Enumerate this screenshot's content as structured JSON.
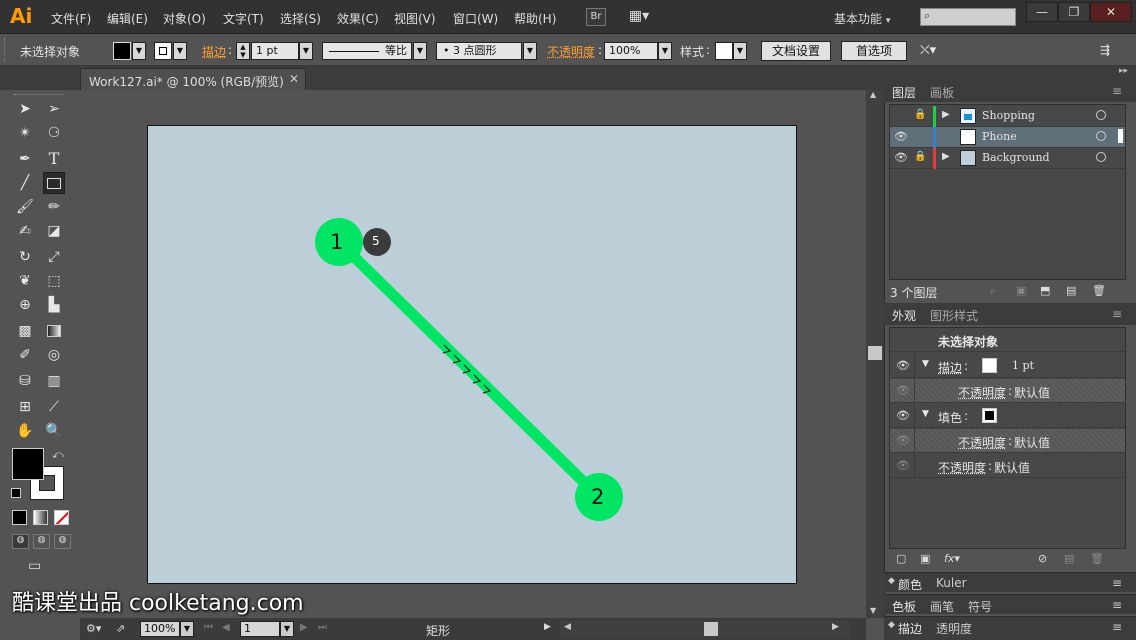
{
  "app": {
    "logo": "Ai"
  },
  "menu": [
    "文件(F)",
    "编辑(E)",
    "对象(O)",
    "文字(T)",
    "选择(S)",
    "效果(C)",
    "视图(V)",
    "窗口(W)",
    "帮助(H)"
  ],
  "menubar": {
    "bridge": "Br",
    "workspace": "基本功能",
    "workspace_arrow": "▾"
  },
  "window_controls": {
    "minimize": "—",
    "restore": "❐",
    "close": "✕"
  },
  "controlbar": {
    "no_selection": "未选择对象",
    "stroke_label": "描边",
    "stroke_value": "1 pt",
    "stroke_profile": "等比",
    "brush": "3 点圆形",
    "opacity_label": "不透明度",
    "opacity_value": "100%",
    "style_label": "样式",
    "doc_setup": "文档设置",
    "preferences": "首选项"
  },
  "document_tab": {
    "label": "Work127.ai* @ 100% (RGB/预览)",
    "close": "✕"
  },
  "canvas": {
    "point1_label": "1",
    "point2_label": "2",
    "badge": "5",
    "line_color": "#00e664",
    "artboard_color": "#bccfd8"
  },
  "statusbar": {
    "zoom": "100%",
    "page": "1",
    "tool": "矩形"
  },
  "layers_panel": {
    "tabs": [
      "图层",
      "画板"
    ],
    "layers": [
      {
        "name": "Shopping",
        "color": "#22cc44",
        "locked": true,
        "visible": false
      },
      {
        "name": "Phone",
        "color": "#3a7bd5",
        "locked": false,
        "visible": true
      },
      {
        "name": "Background",
        "color": "#e23c3c",
        "locked": true,
        "visible": true
      }
    ],
    "count": "3 个图层"
  },
  "appearance_panel": {
    "tabs": [
      "外观",
      "图形样式"
    ],
    "title": "未选择对象",
    "stroke_label": "描边",
    "stroke_value": "1 pt",
    "opacity_label": "不透明度",
    "default_value": "默认值",
    "fill_label": "填色"
  },
  "bottom_panels": {
    "color": [
      "颜色",
      "Kuler"
    ],
    "swatches": [
      "色板",
      "画笔",
      "符号"
    ],
    "stroke": [
      "描边",
      "透明度"
    ]
  },
  "watermark": "酷课堂出品 coolketang.com"
}
